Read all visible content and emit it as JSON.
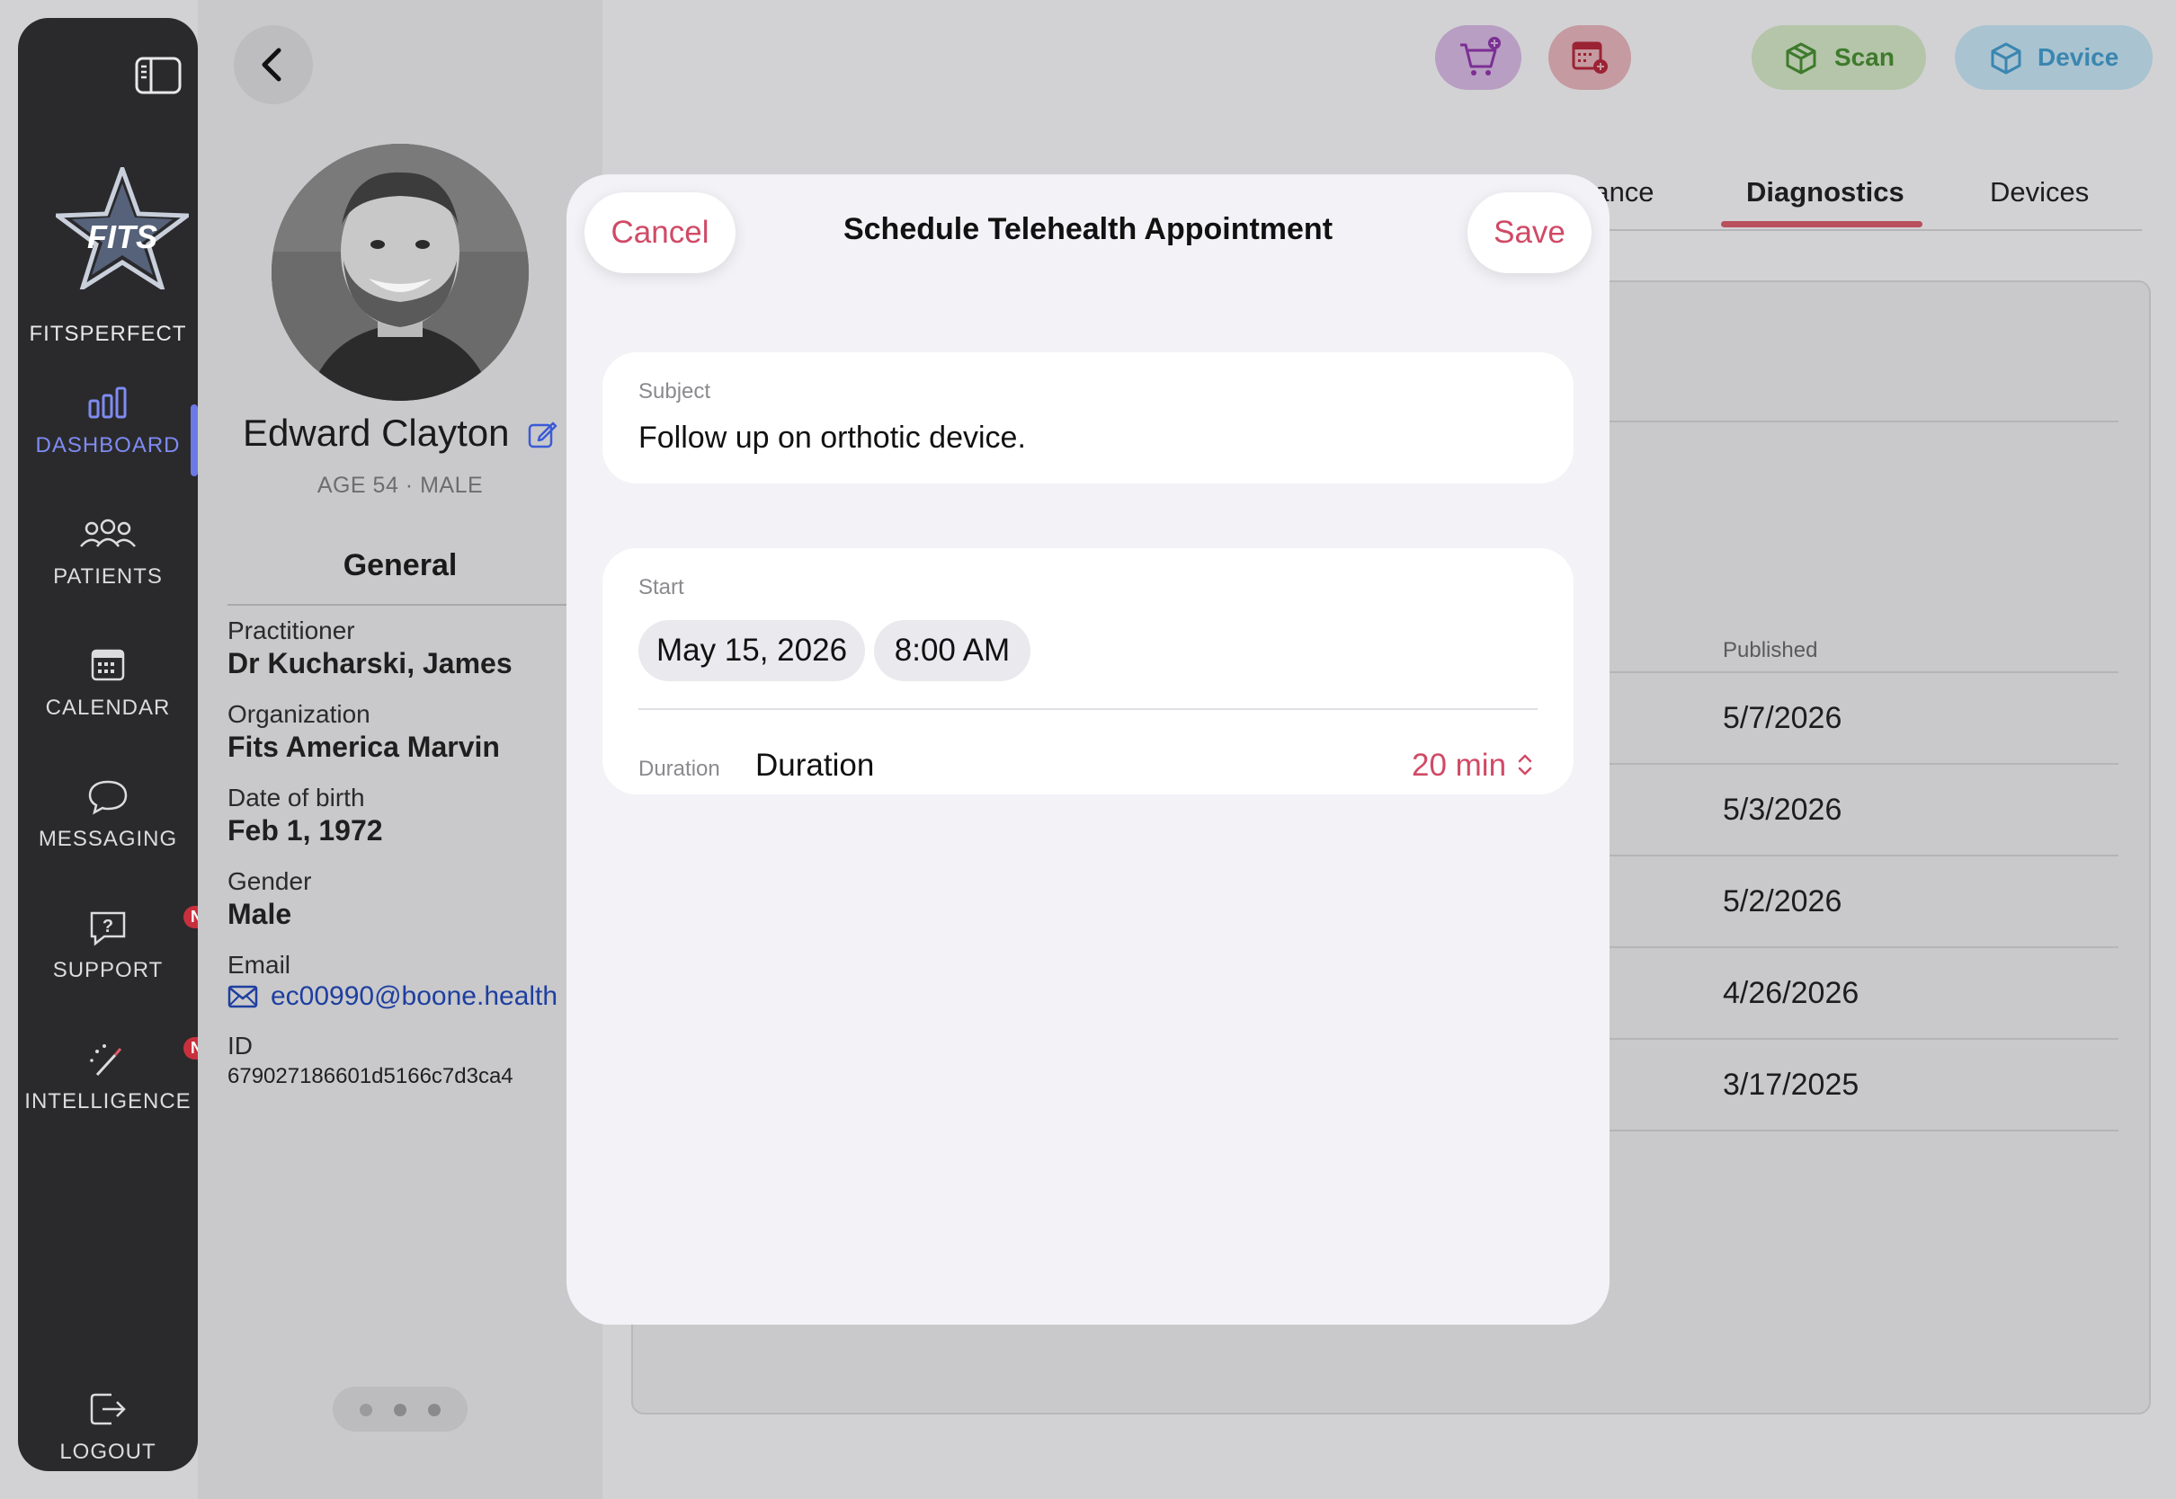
{
  "sidebar": {
    "brand": "FITSPERFECT",
    "logo_text": "FITS",
    "items": [
      {
        "label": "DASHBOARD"
      },
      {
        "label": "PATIENTS"
      },
      {
        "label": "CALENDAR"
      },
      {
        "label": "MESSAGING"
      },
      {
        "label": "SUPPORT",
        "badge": "NEW"
      },
      {
        "label": "INTELLIGENCE",
        "badge": "NEW"
      }
    ],
    "logout": "LOGOUT",
    "accent": "#7f8bf2"
  },
  "patient": {
    "name": "Edward Clayton",
    "age_sex": "AGE 54 · MALE",
    "section": "General",
    "practitioner_label": "Practitioner",
    "practitioner": "Dr Kucharski, James",
    "organization_label": "Organization",
    "organization": "Fits America Marvin",
    "dob_label": "Date of birth",
    "dob": "Feb 1, 1972",
    "gender_label": "Gender",
    "gender": "Male",
    "email_label": "Email",
    "email": "ec00990@boone.health",
    "id_label": "ID",
    "id": "679027186601d5166c7d3ca4"
  },
  "header": {
    "scan_label": "Scan",
    "device_label": "Device",
    "tabs": [
      {
        "label": "rance"
      },
      {
        "label": "Diagnostics",
        "active": true
      },
      {
        "label": "Devices"
      }
    ]
  },
  "table": {
    "published_header": "Published",
    "rows": [
      "5/7/2026",
      "5/3/2026",
      "5/2/2026",
      "4/26/2026",
      "3/17/2025"
    ]
  },
  "modal": {
    "title": "Schedule Telehealth Appointment",
    "cancel": "Cancel",
    "save": "Save",
    "subject_label": "Subject",
    "subject_value": "Follow up on orthotic device.",
    "start_label": "Start",
    "date": "May 15, 2026",
    "time": "8:00 AM",
    "duration_label_small": "Duration",
    "duration_label": "Duration",
    "duration_value": "20 min",
    "accent": "#d04a66"
  }
}
